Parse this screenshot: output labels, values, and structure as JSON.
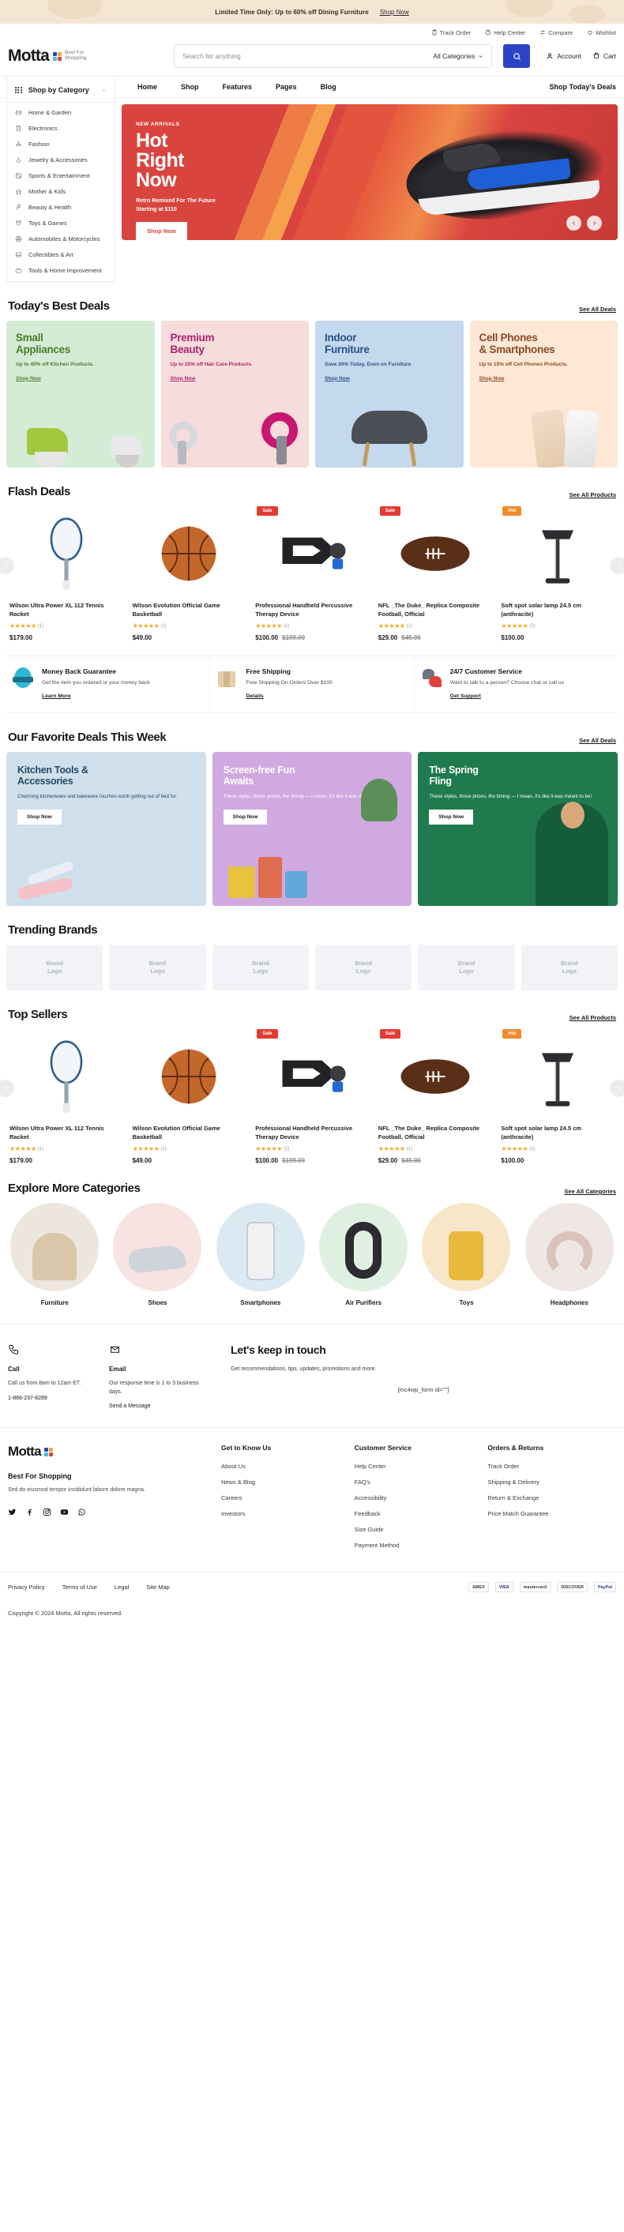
{
  "promo": {
    "text": "Limited Time Only: Up to 60% off Dining Furniture",
    "link": "Shop Now"
  },
  "utility": [
    {
      "label": "Track Order",
      "icon": "clipboard-icon"
    },
    {
      "label": "Help Center",
      "icon": "question-circle-icon"
    },
    {
      "label": "Compare",
      "icon": "compare-icon"
    },
    {
      "label": "Wishlist",
      "icon": "heart-icon"
    }
  ],
  "header": {
    "logo": "Motta",
    "logo_tagline_1": "Best For",
    "logo_tagline_2": "Shopping",
    "search_placeholder": "Search for anything",
    "search_value": "",
    "category_selected": "All Categories",
    "account_label": "Account",
    "cart_label": "Cart"
  },
  "nav": {
    "category_button": "Shop by Category",
    "links": [
      "Home",
      "Shop",
      "Features",
      "Pages",
      "Blog"
    ],
    "today_deals": "Shop Today's Deals"
  },
  "sidebar": {
    "items": [
      {
        "label": "Home & Garden",
        "icon": "sofa-icon"
      },
      {
        "label": "Electronics",
        "icon": "calculator-icon"
      },
      {
        "label": "Fashion",
        "icon": "hanger-icon"
      },
      {
        "label": "Jewelry & Accessories",
        "icon": "ring-icon"
      },
      {
        "label": "Sports & Entertainment",
        "icon": "ball-icon"
      },
      {
        "label": "Mother & Kids",
        "icon": "stroller-icon"
      },
      {
        "label": "Beauty & Health",
        "icon": "mirror-icon"
      },
      {
        "label": "Toys & Games",
        "icon": "bear-icon"
      },
      {
        "label": "Automobiles & Motorcycles",
        "icon": "steering-wheel-icon"
      },
      {
        "label": "Collectibles & Art",
        "icon": "picture-icon"
      },
      {
        "label": "Tools & Home Improvement",
        "icon": "toolbox-icon"
      }
    ]
  },
  "hero": {
    "eyebrow": "NEW ARRIVALS",
    "title_line1": "Hot",
    "title_line2": "Right",
    "title_line3": "Now",
    "sub_line1": "Retro Remixed For The Future",
    "sub_line2": "Starting at $110",
    "button": "Shop Now"
  },
  "best_deals": {
    "title": "Today's Best Deals",
    "see_all": "See All Deals",
    "cards": [
      {
        "title_1": "Small",
        "title_2": "Appliances",
        "desc": "Up to 40% off Kitchen Products.",
        "link": "Shop Now"
      },
      {
        "title_1": "Premium",
        "title_2": "Beauty",
        "desc": "Up to 25% off Hair Care Products.",
        "link": "Shop Now"
      },
      {
        "title_1": "Indoor",
        "title_2": "Furniture",
        "desc": "Save 30% Today, Even on Furniture",
        "link": "Shop Now"
      },
      {
        "title_1": "Cell Phones",
        "title_2": "& Smartphones",
        "desc": "Up to 15% off Cell Phones Products.",
        "link": "Shop Now"
      }
    ]
  },
  "flash_deals": {
    "title": "Flash Deals",
    "see_all": "See All Products",
    "products": [
      {
        "badge": "",
        "title": "Wilson Ultra Power XL 112 Tennis Racket",
        "rating": 5,
        "reviews": "(1)",
        "price": "$179.00",
        "old_price": ""
      },
      {
        "badge": "",
        "title": "Wilson Evolution Official Game Basketball",
        "rating": 5,
        "reviews": "(1)",
        "price": "$49.00",
        "old_price": ""
      },
      {
        "badge": "Sale",
        "title": "Professional Handheld Percussive Therapy Device",
        "rating": 5,
        "reviews": "(1)",
        "price": "$100.00",
        "old_price": "$199.00"
      },
      {
        "badge": "Sale",
        "title": "NFL _The Duke_ Replica Composite Football, Official",
        "rating": 5,
        "reviews": "(1)",
        "price": "$29.00",
        "old_price": "$45.00"
      },
      {
        "badge": "Hot",
        "title": "Soft spot solar lamp 24.5 cm (anthracite)",
        "rating": 5,
        "reviews": "(1)",
        "price": "$100.00",
        "old_price": ""
      }
    ]
  },
  "services": [
    {
      "icon": "guarantee-icon",
      "title": "Money Back Guarantee",
      "desc": "Get the item you ordered or your money back",
      "link": "Learn More"
    },
    {
      "icon": "package-icon",
      "title": "Free Shipping",
      "desc": "Free Shipping On Orders Over $100",
      "link": "Details"
    },
    {
      "icon": "chat-icon",
      "title": "24/7 Customer Service",
      "desc": "Want to talk to a person? Choose chat or call us",
      "link": "Get Support"
    }
  ],
  "favorites": {
    "title": "Our Favorite Deals This Week",
    "see_all": "See All Deals",
    "cards": [
      {
        "title_1": "Kitchen Tools &",
        "title_2": "Accessories",
        "desc": "Charming kitchenware and bakeware touches worth getting out of bed for.",
        "button": "Shop Now"
      },
      {
        "title_1": "Screen-free Fun",
        "title_2": "Awaits",
        "desc": "These styles, those prices, the timing — I mean, it's like it was meant to be!",
        "button": "Shop Now"
      },
      {
        "title_1": "The Spring",
        "title_2": "Fling",
        "desc": "These styles, those prices, the timing — I mean, it's like it was meant to be!",
        "button": "Shop Now"
      }
    ]
  },
  "brands": {
    "title": "Trending Brands",
    "items": [
      {
        "line1": "Brand",
        "line2": "Logo"
      },
      {
        "line1": "Brand",
        "line2": "Logo"
      },
      {
        "line1": "Brand",
        "line2": "Logo"
      },
      {
        "line1": "Brand",
        "line2": "Logo"
      },
      {
        "line1": "Brand",
        "line2": "Logo"
      },
      {
        "line1": "Brand",
        "line2": "Logo"
      }
    ]
  },
  "top_sellers": {
    "title": "Top Sellers",
    "see_all": "See All Products",
    "products": [
      {
        "badge": "",
        "title": "Wilson Ultra Power XL 112 Tennis Racket",
        "rating": 5,
        "reviews": "(1)",
        "price": "$179.00",
        "old_price": ""
      },
      {
        "badge": "",
        "title": "Wilson Evolution Official Game Basketball",
        "rating": 5,
        "reviews": "(1)",
        "price": "$49.00",
        "old_price": ""
      },
      {
        "badge": "Sale",
        "title": "Professional Handheld Percussive Therapy Device",
        "rating": 5,
        "reviews": "(1)",
        "price": "$100.00",
        "old_price": "$199.00"
      },
      {
        "badge": "Sale",
        "title": "NFL _The Duke_ Replica Composite Football, Official",
        "rating": 5,
        "reviews": "(1)",
        "price": "$29.00",
        "old_price": "$45.00"
      },
      {
        "badge": "Hot",
        "title": "Soft spot solar lamp 24.5 cm (anthracite)",
        "rating": 5,
        "reviews": "(1)",
        "price": "$100.00",
        "old_price": ""
      }
    ]
  },
  "categories": {
    "title": "Explore More Categories",
    "see_all": "See All Categories",
    "items": [
      {
        "label": "Furniture"
      },
      {
        "label": "Shoes"
      },
      {
        "label": "Smartphones"
      },
      {
        "label": "Air Purifiers"
      },
      {
        "label": "Toys"
      },
      {
        "label": "Headphones"
      }
    ]
  },
  "contact": {
    "call": {
      "icon": "phone-icon",
      "heading": "Call",
      "desc": "Call us from 8am to 12am ET.",
      "link": "1-866-237-8289"
    },
    "email": {
      "icon": "envelope-icon",
      "heading": "Email",
      "desc": "Our response time is 1 to 3 business days.",
      "link": "Send a Message"
    }
  },
  "newsletter": {
    "title": "Let's keep in touch",
    "desc": "Get recommendations, tips, updates, promotions and more.",
    "shortcode": "[mc4wp_form id=\"\"]"
  },
  "footer": {
    "logo": "Motta",
    "tagline": "Best For Shopping",
    "description": "Sed do eiusmod tempor incididunt labore dolore magna.",
    "social": [
      "twitter-icon",
      "facebook-icon",
      "instagram-icon",
      "youtube-icon",
      "whatsapp-icon"
    ],
    "columns": [
      {
        "title": "Get to Know Us",
        "links": [
          "About Us",
          "News & Blog",
          "Careers",
          "Investors"
        ]
      },
      {
        "title": "Customer Service",
        "links": [
          "Help Center",
          "FAQ's",
          "Accessibility",
          "Feedback",
          "Size Guide",
          "Payment Method"
        ]
      },
      {
        "title": "Orders & Returns",
        "links": [
          "Track Order",
          "Shipping & Delivery",
          "Return & Exchange",
          "Price Match Guarantee"
        ]
      }
    ]
  },
  "legal": {
    "links": [
      "Privacy Policy",
      "Terms of Use",
      "Legal",
      "Site Map"
    ],
    "payments": [
      "AMEX",
      "VISA",
      "mastercard",
      "DISCOVER",
      "PayPal"
    ],
    "copyright": "Copyright © 2024 Motta, All rights reserved."
  }
}
